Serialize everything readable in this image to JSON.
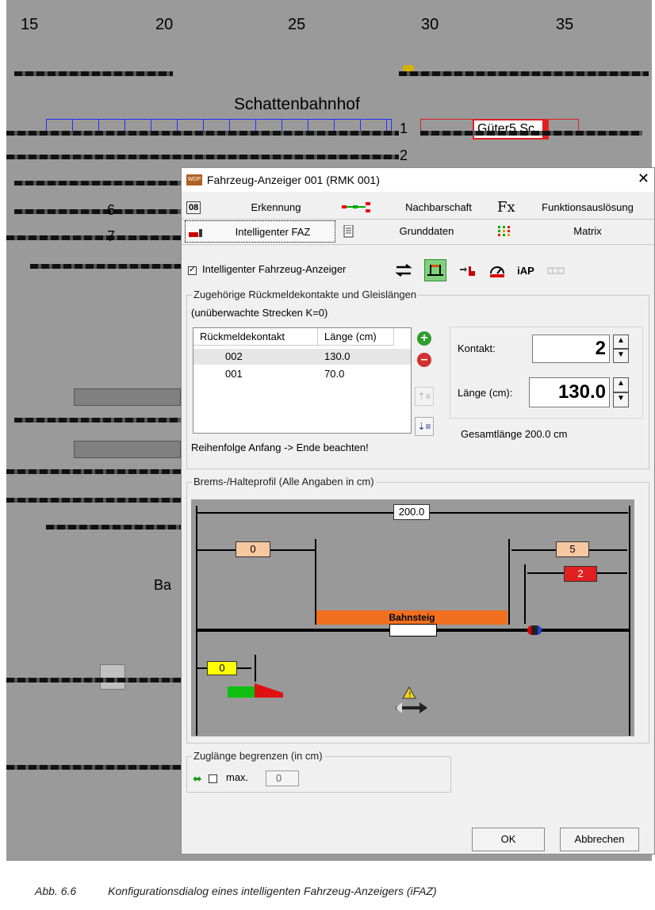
{
  "layout": {
    "column_numbers": [
      "15",
      "20",
      "25",
      "30",
      "35"
    ],
    "station_label": "Schattenbahnhof",
    "freight_label": "Güter5 Sc",
    "track_numbers_big": [
      "1",
      "2",
      "6",
      "7"
    ],
    "station_partial": "Ba"
  },
  "dialog": {
    "title": "Fahrzeug-Anzeiger 001 (RMK 001)",
    "close_glyph": "✕",
    "app_icon_text": "WDP",
    "tabs_row1": [
      {
        "icon_text": "08",
        "label": "Erkennung"
      },
      {
        "label": "Nachbarschaft"
      },
      {
        "icon_text": "Fx",
        "label": "Funktionsauslösung"
      }
    ],
    "tabs_row2": [
      {
        "label": "Intelligenter FAZ"
      },
      {
        "label": "Grunddaten"
      },
      {
        "label": "Matrix"
      }
    ],
    "ifaz_checkbox": "Intelligenter Fahrzeug-Anzeiger",
    "toolbar": {
      "iap": "iAP"
    },
    "contacts_group": {
      "title": "Zugehörige Rückmeldekontakte und Gleislängen",
      "subtitle": "(unüberwachte Strecken K=0)",
      "col_contact": "Rückmeldekontakt",
      "col_length": "Länge (cm)",
      "rows": [
        {
          "contact": "002",
          "length": "130.0"
        },
        {
          "contact": "001",
          "length": "70.0"
        }
      ],
      "hint": "Reihenfolge Anfang -> Ende beachten!",
      "kontakt_label": "Kontakt:",
      "kontakt_value": "2",
      "laenge_label": "Länge (cm):",
      "laenge_value": "130.0",
      "total": "Gesamtlänge 200.0 cm"
    },
    "profile_group": {
      "title": "Brems-/Halteprofil (Alle Angaben in cm)",
      "total_length": "200.0",
      "left_offset": "0",
      "right_offset": "5",
      "right_stop": "2",
      "platform": "Bahnsteig",
      "start_offset": "0"
    },
    "length_group": {
      "title": "Zuglänge begrenzen (in cm)",
      "max_label": "max.",
      "max_value": "0"
    },
    "buttons": {
      "ok": "OK",
      "cancel": "Abbrechen"
    }
  },
  "caption": {
    "number": "Abb. 6.6",
    "text": "Konfigurationsdialog eines intelligenten Fahrzeug-Anzeigers (iFAZ)"
  }
}
